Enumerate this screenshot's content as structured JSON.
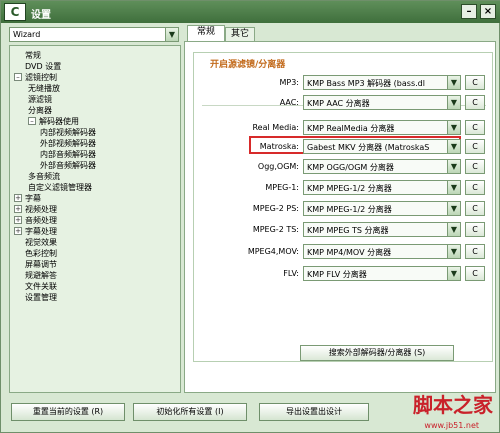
{
  "titlebar": {
    "title": "设置",
    "app_icon_glyph": "C",
    "close_glyph": "×",
    "minimize_glyph": "–"
  },
  "profile": {
    "value": "Wizard"
  },
  "tree": {
    "collapse_glyph": "–",
    "expand_glyph": "+",
    "items": [
      {
        "label": "常规",
        "level": 0,
        "exp": ""
      },
      {
        "label": "DVD 设置",
        "level": 0,
        "exp": ""
      },
      {
        "label": "滤镜控制",
        "level": 0,
        "exp": "–"
      },
      {
        "label": "无缝播放",
        "level": 1,
        "exp": ""
      },
      {
        "label": "源滤镜",
        "level": 1,
        "exp": ""
      },
      {
        "label": "分离器",
        "level": 1,
        "exp": ""
      },
      {
        "label": "解码器使用",
        "level": 1,
        "exp": "–"
      },
      {
        "label": "内部视频解码器",
        "level": 2,
        "exp": ""
      },
      {
        "label": "外部视频解码器",
        "level": 2,
        "exp": ""
      },
      {
        "label": "内部音频解码器",
        "level": 2,
        "exp": ""
      },
      {
        "label": "外部音频解码器",
        "level": 2,
        "exp": ""
      },
      {
        "label": "多音频流",
        "level": 1,
        "exp": ""
      },
      {
        "label": "自定义滤镜管理器",
        "level": 1,
        "exp": ""
      },
      {
        "label": "字幕",
        "level": 0,
        "exp": "+"
      },
      {
        "label": "视频处理",
        "level": 0,
        "exp": "+"
      },
      {
        "label": "音频处理",
        "level": 0,
        "exp": "+"
      },
      {
        "label": "字幕处理",
        "level": 0,
        "exp": "+"
      },
      {
        "label": "视觉效果",
        "level": 0,
        "exp": ""
      },
      {
        "label": "色彩控制",
        "level": 0,
        "exp": ""
      },
      {
        "label": "屏幕调节",
        "level": 0,
        "exp": ""
      },
      {
        "label": "规避解答",
        "level": 0,
        "exp": ""
      },
      {
        "label": "文件关联",
        "level": 0,
        "exp": ""
      },
      {
        "label": "设置管理",
        "level": 0,
        "exp": ""
      }
    ]
  },
  "tabs": [
    {
      "label": "常规"
    },
    {
      "label": "其它"
    }
  ],
  "group": {
    "title": "开启源滤镜/分离器",
    "config_label": "C",
    "rows": [
      {
        "label": "MP3:",
        "value": "KMP Bass MP3 解码器 (bass.dl"
      },
      {
        "label": "AAC:",
        "value": "KMP AAC 分离器"
      },
      {
        "label": "Real Media:",
        "value": "KMP RealMedia 分离器"
      },
      {
        "label": "Matroska:",
        "value": "Gabest MKV 分离器 (MatroskaS"
      },
      {
        "label": "Ogg,OGM:",
        "value": "KMP OGG/OGM 分离器"
      },
      {
        "label": "MPEG-1:",
        "value": "KMP MPEG-1/2 分离器"
      },
      {
        "label": "MPEG-2 PS:",
        "value": "KMP MPEG-1/2 分离器"
      },
      {
        "label": "MPEG-2 TS:",
        "value": "KMP MPEG TS 分离器"
      },
      {
        "label": "MPEG4,MOV:",
        "value": "KMP MP4/MOV 分离器"
      },
      {
        "label": "FLV:",
        "value": "KMP FLV 分离器"
      }
    ],
    "search_button": "搜索外部解码器/分离器 (S)"
  },
  "bottom": {
    "reset_current": "重置当前的设置 (R)",
    "init_all": "初始化所有设置 (I)",
    "export_settings": "导出设置出设计"
  },
  "watermark": {
    "text": "脚本之家",
    "url": "www.jb51.net"
  },
  "colors": {
    "highlight": "#d72a2a",
    "group_title": "#c26a1b",
    "titlebar": "#4f7f4b"
  }
}
